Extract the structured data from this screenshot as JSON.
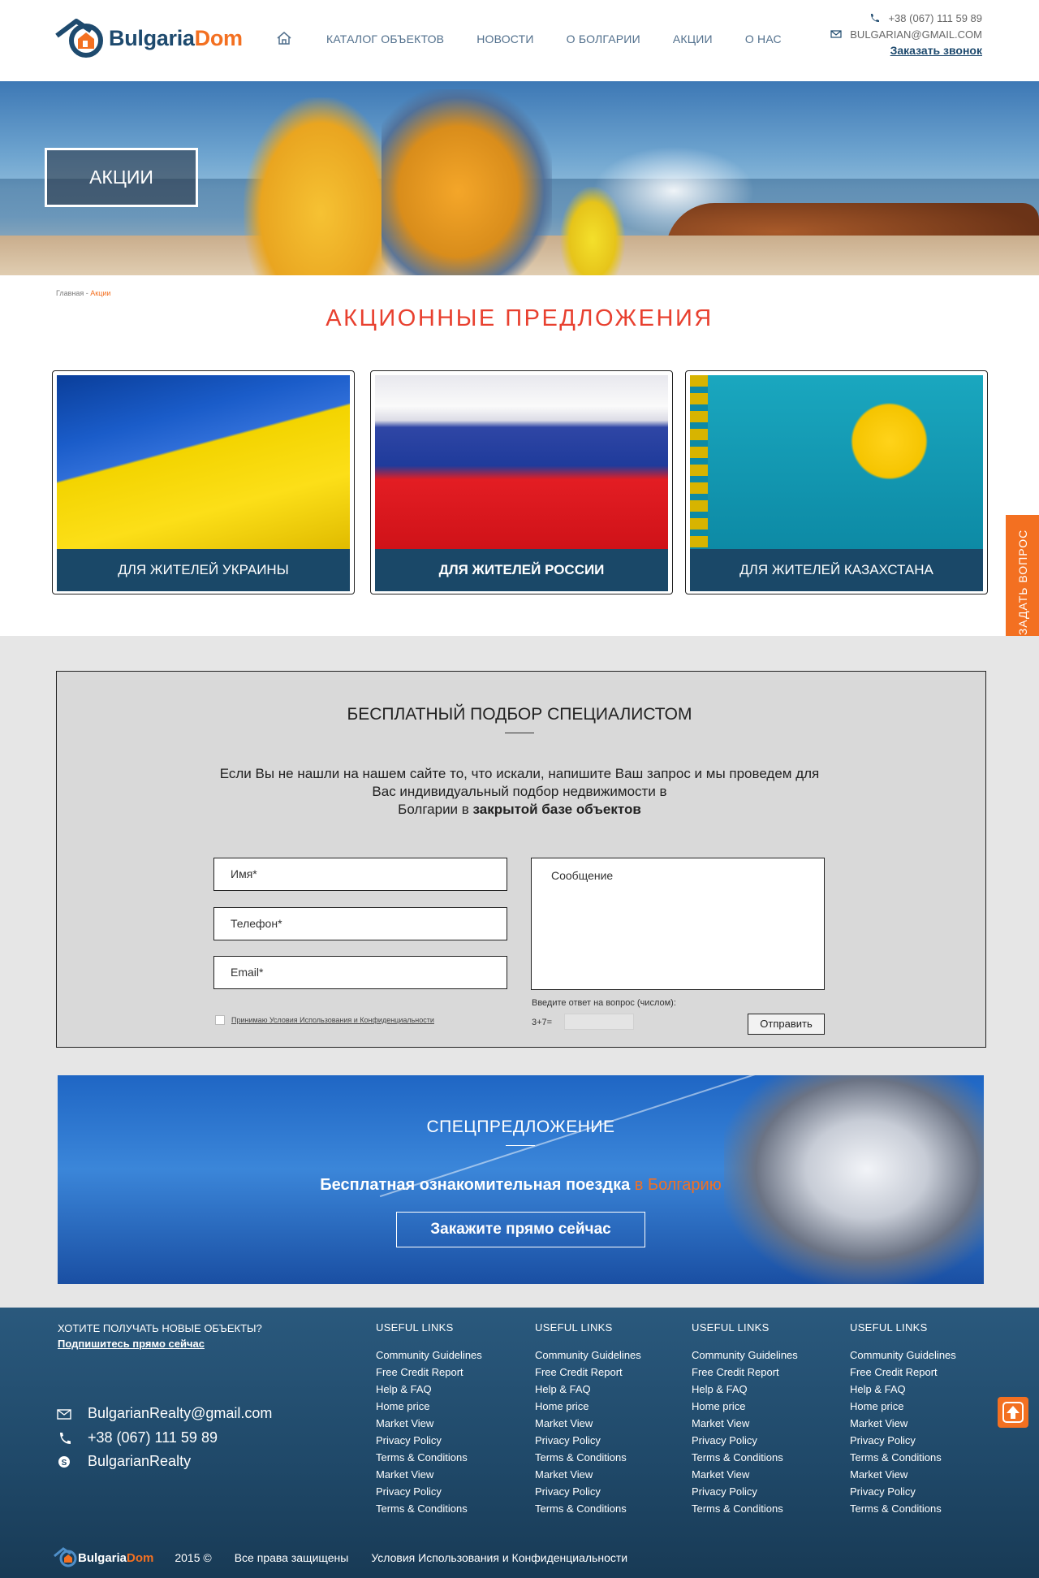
{
  "header": {
    "logo": {
      "part1": "Bulgaria",
      "part2": "Dom"
    },
    "nav": [
      "КАТАЛОГ ОБЪЕКТОВ",
      "НОВОСТИ",
      "О БОЛГАРИИ",
      "АКЦИИ",
      "О НАС"
    ],
    "phone": "+38 (067) 111 59 89",
    "email": "BULGARIAN@GMAIL.COM",
    "callback": "Заказать звонок"
  },
  "hero": {
    "title": "АКЦИИ"
  },
  "breadcrumb": {
    "home": "Главная",
    "sep": " - ",
    "current": "Акции"
  },
  "page_title": "АКЦИОННЫЕ ПРЕДЛОЖЕНИЯ",
  "cards": [
    {
      "label": "ДЛЯ ЖИТЕЛЕЙ УКРАИНЫ"
    },
    {
      "label": "ДЛЯ ЖИТЕЛЕЙ РОССИИ"
    },
    {
      "label": "ДЛЯ ЖИТЕЛЕЙ КАЗАХСТАНА"
    }
  ],
  "ask_tab": "ЗАДАТЬ ВОПРОС",
  "form": {
    "title": "БЕСПЛАТНЫЙ ПОДБОР СПЕЦИАЛИСТОМ",
    "text_line1": "Если Вы не нашли на нашем сайте то, что искали, напишите Ваш запрос и мы проведем для",
    "text_line2": "Вас индивидуальный подбор недвижимости в",
    "text_line3_a": "Болгарии в ",
    "text_line3_b": "закрытой базе объектов",
    "name_placeholder": "Имя*",
    "phone_placeholder": "Телефон*",
    "email_placeholder": "Email*",
    "message_placeholder": "Сообщение",
    "agree_text": "Принимаю Условия Использования и Конфиденциальности",
    "captcha_question": "Введите ответ на вопрос (числом):",
    "captcha_expr": "3+7=",
    "submit": "Отправить"
  },
  "promo": {
    "title": "СПЕЦПРЕДЛОЖЕНИЕ",
    "sub_a": "Бесплатная ознакомительная поездка ",
    "sub_b": "в Болгарию",
    "button": "Закажите прямо сейчас"
  },
  "footer": {
    "subscribe_question": "ХОТИТЕ ПОЛУЧАТЬ НОВЫЕ ОБЪЕКТЫ?",
    "subscribe_link": "Подпишитесь прямо сейчас",
    "email": "BulgarianRealty@gmail.com",
    "phone": "+38 (067) 111 59 89",
    "skype": "BulgarianRealty",
    "link_columns": [
      {
        "heading": "USEFUL LINKS",
        "links": [
          "Community Guidelines",
          "Free Credit Report",
          "Help & FAQ",
          "Home price",
          "Market View",
          "Privacy Policy",
          "Terms & Conditions",
          "Market View",
          "Privacy Policy",
          "Terms & Conditions"
        ]
      },
      {
        "heading": "USEFUL LINKS",
        "links": [
          "Community Guidelines",
          "Free Credit Report",
          "Help & FAQ",
          "Home price",
          "Market View",
          "Privacy Policy",
          "Terms & Conditions",
          "Market View",
          "Privacy Policy",
          "Terms & Conditions"
        ]
      },
      {
        "heading": "USEFUL LINKS",
        "links": [
          "Community Guidelines",
          "Free Credit Report",
          "Help & FAQ",
          "Home price",
          "Market View",
          "Privacy Policy",
          "Terms & Conditions",
          "Market View",
          "Privacy Policy",
          "Terms & Conditions"
        ]
      },
      {
        "heading": "USEFUL LINKS",
        "links": [
          "Community Guidelines",
          "Free Credit Report",
          "Help & FAQ",
          "Home price",
          "Market View",
          "Privacy Policy",
          "Terms & Conditions",
          "Market View",
          "Privacy Policy",
          "Terms & Conditions"
        ]
      }
    ],
    "bottom_logo": {
      "part1": "Bulgaria",
      "part2": "Dom"
    },
    "year": "2015 ©",
    "rights": "Все права защищены",
    "terms": "Условия Использования и Конфиденциальности"
  },
  "icons": {
    "home": "home-icon",
    "phone": "phone-icon",
    "email": "envelope-icon",
    "skype": "skype-icon",
    "to_top": "arrow-up-icon"
  },
  "colors": {
    "brand_blue": "#1e4a6e",
    "brand_orange": "#f37021",
    "title_red": "#e8402f",
    "card_label_bg": "#1a4868"
  }
}
